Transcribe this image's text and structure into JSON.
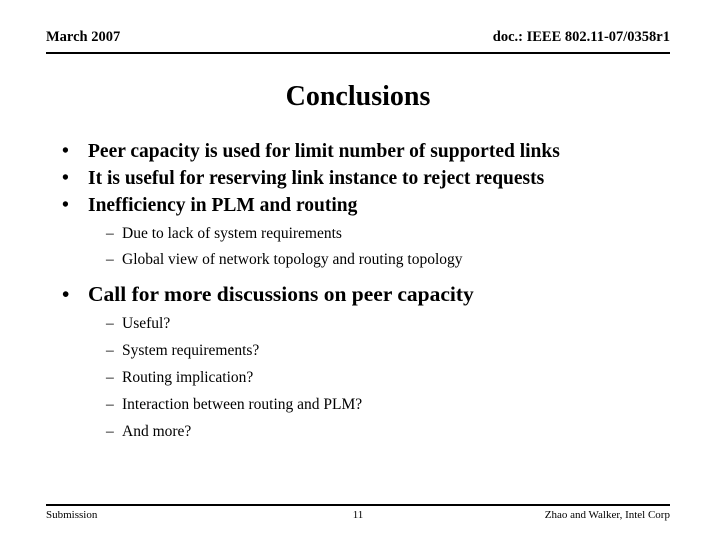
{
  "header": {
    "date": "March 2007",
    "doc_id": "doc.: IEEE 802.11-07/0358r1"
  },
  "title": "Conclusions",
  "content": {
    "bullets": [
      {
        "marker": "•",
        "text": "Peer capacity is used for limit number of supported links"
      },
      {
        "marker": "•",
        "text": "It is useful for reserving link instance to reject requests"
      },
      {
        "marker": "•",
        "text": "Inefficiency in PLM and routing"
      },
      {
        "marker": "•",
        "text": "Call for more discussions on peer capacity"
      }
    ],
    "sub_group_1": [
      {
        "marker": "–",
        "text": "Due to lack of system requirements"
      },
      {
        "marker": "–",
        "text": "Global view of network topology and routing topology"
      }
    ],
    "sub_group_2": [
      {
        "marker": "–",
        "text": "Useful?"
      },
      {
        "marker": "–",
        "text": "System requirements?"
      },
      {
        "marker": "–",
        "text": "Routing implication?"
      },
      {
        "marker": "–",
        "text": "Interaction between routing and PLM?"
      },
      {
        "marker": "–",
        "text": "And more?"
      }
    ]
  },
  "footer": {
    "left": "Submission",
    "page_number": "11",
    "right": "Zhao and Walker, Intel Corp"
  },
  "colors": {
    "text": "#000000",
    "background": "#ffffff",
    "rule": "#000000"
  }
}
